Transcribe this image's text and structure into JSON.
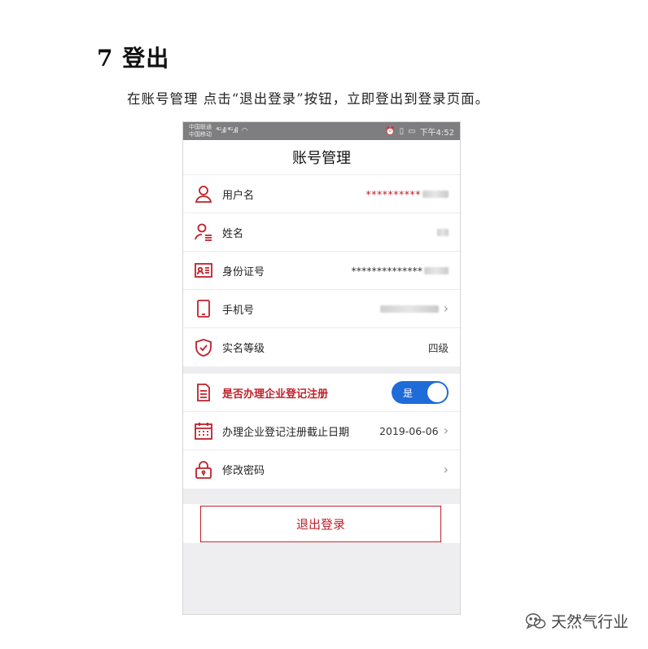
{
  "document": {
    "heading": "7 登出",
    "paragraph": "在账号管理 点击“退出登录”按钮，立即登出到登录页面。"
  },
  "status_bar": {
    "carrier_1": "中国联通",
    "carrier_2": "中国移动",
    "signal": "⁴ᴳ.ıll ⁴ᴳ.ıll",
    "time": "下午4:52"
  },
  "screen": {
    "title": "账号管理"
  },
  "profile_rows": [
    {
      "label": "用户名",
      "value": "**********",
      "icon": "user-icon"
    },
    {
      "label": "姓名",
      "value": "",
      "icon": "user-lines-icon"
    },
    {
      "label": "身份证号",
      "value": "**************",
      "icon": "id-card-icon"
    },
    {
      "label": "手机号",
      "value": "",
      "icon": "phone-icon"
    },
    {
      "label": "实名等级",
      "value": "四级",
      "icon": "shield-check-icon"
    }
  ],
  "settings_rows": [
    {
      "label": "是否办理企业登记注册",
      "toggle_text": "是",
      "toggle_on": true,
      "icon": "document-icon"
    },
    {
      "label": "办理企业登记注册截止日期",
      "value": "2019-06-06",
      "icon": "calendar-icon"
    },
    {
      "label": "修改密码",
      "value": "",
      "icon": "lock-icon"
    }
  ],
  "logout": {
    "label": "退出登录"
  },
  "watermark": {
    "text": "天然气行业"
  },
  "colors": {
    "accent_red": "#c0202a",
    "toggle_blue": "#1f6bd8"
  }
}
